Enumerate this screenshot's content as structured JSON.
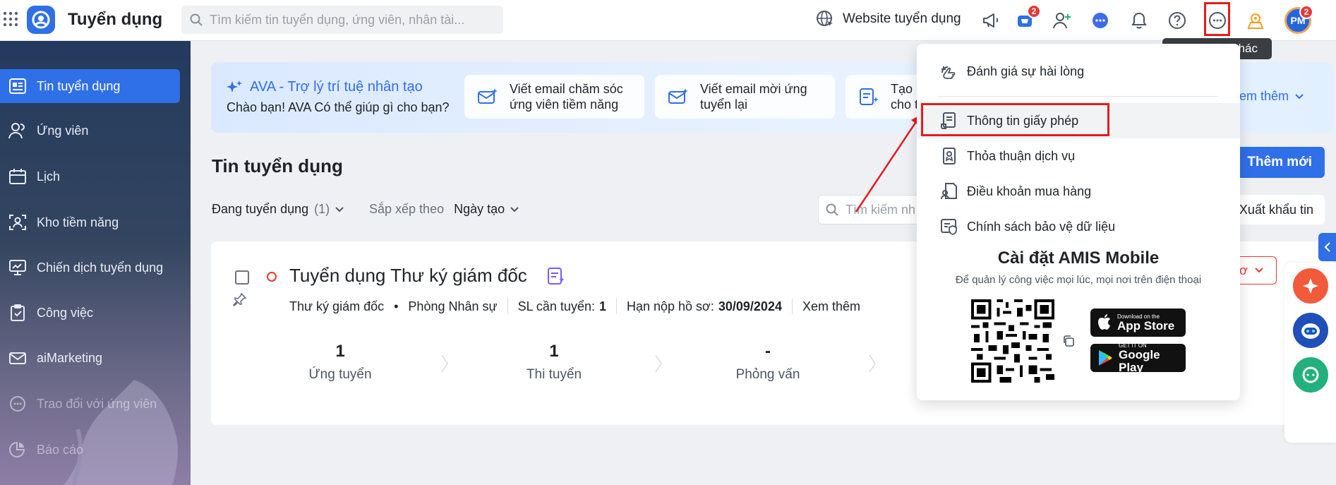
{
  "header": {
    "app_title": "Tuyển dụng",
    "search_placeholder": "Tìm kiếm tin tuyển dụng, ứng viên, nhân tài...",
    "website_link": "Website tuyển dụng",
    "cart_badge": "2",
    "avatar_initials": "PM",
    "avatar_badge": "2",
    "more_tooltip": "hác"
  },
  "sidebar": {
    "items": [
      {
        "label": "Tin tuyển dụng",
        "icon": "job-post-icon",
        "active": true
      },
      {
        "label": "Ứng viên",
        "icon": "candidates-icon"
      },
      {
        "label": "Lịch",
        "icon": "calendar-icon"
      },
      {
        "label": "Kho tiềm năng",
        "icon": "talent-pool-icon"
      },
      {
        "label": "Chiến dịch tuyển dụng",
        "icon": "campaign-icon"
      },
      {
        "label": "Công việc",
        "icon": "task-icon"
      },
      {
        "label": "aiMarketing",
        "icon": "mail-icon"
      },
      {
        "label": "Trao đổi với ứng viên",
        "icon": "chat-icon"
      },
      {
        "label": "Báo cáo",
        "icon": "report-icon"
      }
    ]
  },
  "ava": {
    "title": "AVA - Trợ lý trí tuệ nhân tạo",
    "subtitle": "Chào bạn! AVA Có thể giúp gì cho bạn?",
    "cards": [
      {
        "line1": "Viết email chăm sóc",
        "line2": "ứng viên tiềm năng"
      },
      {
        "line1": "Viết email mời ứng",
        "line2": "tuyển lại"
      },
      {
        "line1": "Tạo",
        "line2": "cho t"
      }
    ],
    "more": "em thêm"
  },
  "main": {
    "title": "Tin tuyển dụng",
    "add_button": "Thêm mới",
    "filter_status": "Đang tuyển dụng",
    "filter_count": "(1)",
    "sort_label": "Sắp xếp theo",
    "sort_value": "Ngày tạo",
    "search_placeholder": "Tìm kiếm nh",
    "export_button": "Xuất khẩu tin"
  },
  "job": {
    "title": "Tuyển dụng Thư ký giám đốc",
    "position": "Thư ký giám đốc",
    "department": "Phòng Nhân sự",
    "quantity_label": "SL cần tuyển:",
    "quantity": "1",
    "deadline_label": "Hạn nộp hồ sơ:",
    "deadline": "30/09/2024",
    "more": "Xem thêm",
    "status_text": "ơ",
    "stats": [
      {
        "num": "1",
        "label": "Ứng tuyển"
      },
      {
        "num": "1",
        "label": "Thi tuyển"
      },
      {
        "num": "-",
        "label": "Phỏng vấn"
      }
    ]
  },
  "dropdown": {
    "items": [
      {
        "label": "Đánh giá sự hài lòng",
        "icon": "satisfaction-icon"
      },
      {
        "label": "Thông tin giấy phép",
        "icon": "license-icon"
      },
      {
        "label": "Thỏa thuận dịch vụ",
        "icon": "agreement-icon"
      },
      {
        "label": "Điều khoản mua hàng",
        "icon": "purchase-terms-icon"
      },
      {
        "label": "Chính sách bảo vệ dữ liệu",
        "icon": "data-policy-icon"
      }
    ],
    "mobile_title": "Cài đặt AMIS Mobile",
    "mobile_subtitle": "Để quản lý công việc mọi lúc, mọi nơi trên điện thoại",
    "app_store": {
      "small": "Download on the",
      "big": "App Store"
    },
    "google_play": {
      "small": "GET IT ON",
      "big": "Google Play"
    }
  },
  "colors": {
    "accent": "#2f6fe8",
    "highlight": "#e11d1d",
    "danger": "#e53935"
  }
}
